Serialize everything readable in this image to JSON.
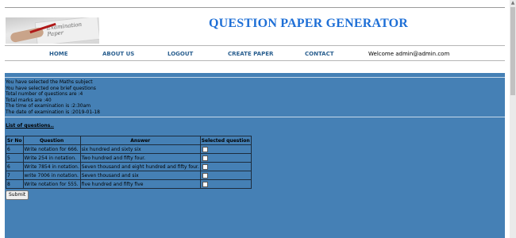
{
  "header": {
    "title": "QUESTION PAPER GENERATOR",
    "banner_text": "Examination Paper"
  },
  "nav": {
    "home": "HOME",
    "about": "ABOUT US",
    "logout": "LOGOUT",
    "create": "CREATE PAPER",
    "contact": "CONTACT",
    "welcome": "Welcome admin@admin.com"
  },
  "info": {
    "line1": "You have selected the Maths subject",
    "line2": "You have selected one brief questions",
    "line3": "Total number of questions are :4",
    "line4": "Total marks are :40",
    "line5": "The time of examination is :2:30am",
    "line6": "The date of examination is :2019-01-18"
  },
  "list_title": "List of questions..",
  "table": {
    "headers": [
      "Sr No",
      "Question",
      "Answer",
      "Selected question"
    ],
    "rows": [
      {
        "sr": "6",
        "question": "Write notation for 666.",
        "answer": "six hundred and sixty six"
      },
      {
        "sr": "5",
        "question": "Write 254 in notation.",
        "answer": "Two hundred and fifty four."
      },
      {
        "sr": "6",
        "question": "Write 7854 in notation.",
        "answer": "Seven thousand and eight hundred and fifty four."
      },
      {
        "sr": "7",
        "question": "write 7006 in notation.",
        "answer": "Seven thousand and six"
      },
      {
        "sr": "8",
        "question": "Write notation for 555.",
        "answer": "five hundred and fifty five"
      }
    ]
  },
  "submit_label": "Submit",
  "colors": {
    "title": "#1e6fd6",
    "nav": "#2a5f8f",
    "content_bg": "#4580b5"
  }
}
